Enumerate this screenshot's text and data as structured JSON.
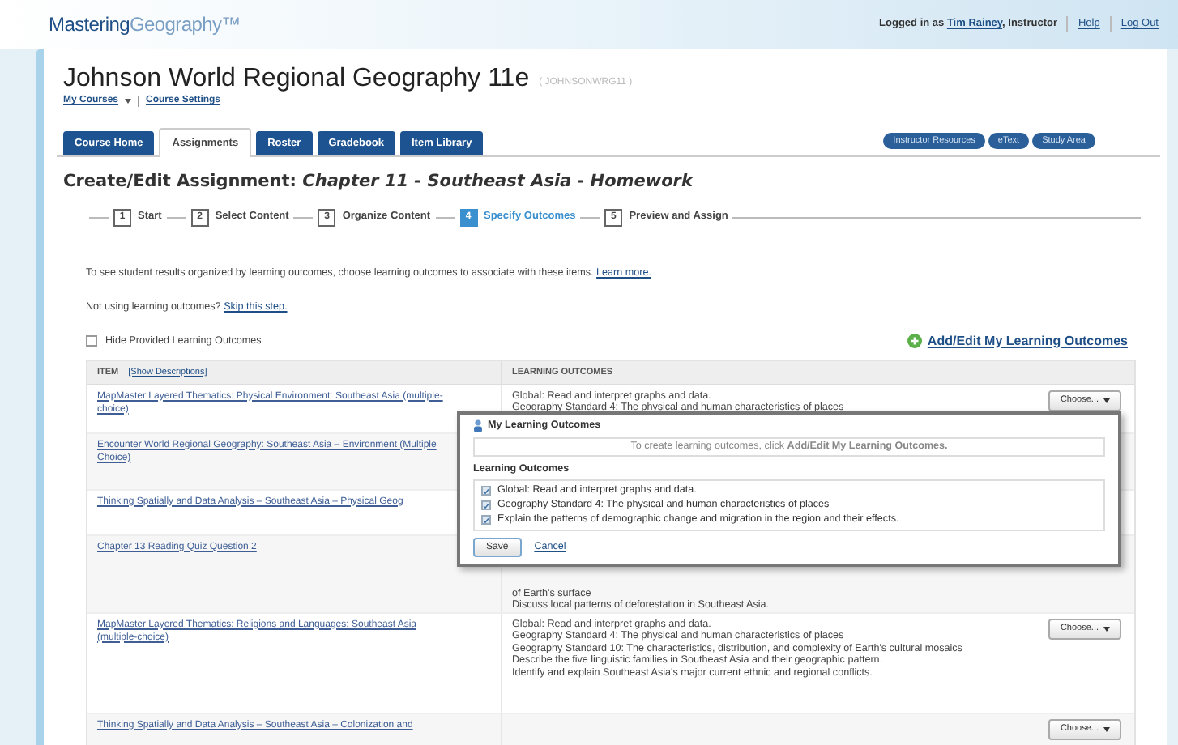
{
  "header": {
    "logo": [
      "Mastering",
      "Geography™"
    ],
    "login_prefix": "Logged in as",
    "user": "Tim Rainey",
    "role": ", Instructor",
    "links": [
      "Help",
      "Log Out"
    ]
  },
  "course": {
    "title": "Johnson World Regional Geography 11e",
    "code": "( JOHNSONWRG11 )",
    "links": [
      {
        "label": "My Courses",
        "dropdown": true
      },
      {
        "label": "Course Settings",
        "dropdown": false
      }
    ]
  },
  "tabs": [
    {
      "label": "Course Home",
      "selected": false
    },
    {
      "label": "Assignments",
      "selected": true
    },
    {
      "label": "Roster",
      "selected": false
    },
    {
      "label": "Gradebook",
      "selected": false
    },
    {
      "label": "Item Library",
      "selected": false
    }
  ],
  "resource_buttons": [
    "Instructor Resources",
    "eText",
    "Study Area"
  ],
  "page_title": "Create/Edit Assignment: *Chapter 11 - Southeast Asia - Homework*",
  "steps": [
    {
      "number": "1",
      "label": "Start",
      "selected": false
    },
    {
      "number": "2",
      "label": "Select Content",
      "selected": false
    },
    {
      "number": "3",
      "label": "Organize Content",
      "selected": false
    },
    {
      "number": "4",
      "label": "Specify Outcomes",
      "selected": true
    },
    {
      "number": "5",
      "label": "Preview and Assign",
      "selected": false
    }
  ],
  "intro": {
    "text": "To see student results organized by learning outcomes, choose learning outcomes to associate with these items.",
    "link": "Learn more."
  },
  "skip": {
    "text": "Not using learning outcomes?",
    "link": "Skip this step."
  },
  "hide_provided": {
    "label": "Hide Provided Learning Outcomes",
    "checked": false
  },
  "add_edit_link": "Add/Edit My Learning Outcomes",
  "table": {
    "columns": [
      {
        "label": "ITEM",
        "link": "[Show Descriptions]"
      },
      {
        "label": "LEARNING OUTCOMES"
      }
    ],
    "rows": [
      {
        "item": "MapMaster Layered Thematics: Physical Environment: Southeast Asia (multiple-choice)",
        "outcomes": [
          "Global: Read and interpret graphs and data.",
          "Geography Standard 4: The physical and human characteristics of places"
        ],
        "button": "Choose..."
      },
      {
        "item": "Encounter World Regional Geography: Southeast Asia – Environment (Multiple Choice)"
      },
      {
        "item": "Thinking Spatially and Data Analysis – Southeast Asia – Physical Geog"
      },
      {
        "item": "Chapter 13 Reading Quiz Question 2",
        "outcomes": [
          "of Earth's surface",
          "Discuss local patterns of deforestation in Southeast Asia."
        ]
      },
      {
        "item": "MapMaster Layered Thematics: Religions and Languages: Southeast Asia (multiple-choice)",
        "outcomes": [
          "Global: Read and interpret graphs and data.",
          "Geography Standard 4: The physical and human characteristics of places",
          "Geography Standard 10: The characteristics, distribution, and complexity of Earth's cultural mosaics",
          "Describe the five linguistic families in Southeast Asia and their geographic pattern.",
          "Identify and explain Southeast Asia's major current ethnic and regional conflicts."
        ],
        "button": "Choose..."
      },
      {
        "item": "Thinking Spatially and Data Analysis – Southeast Asia – Colonization and",
        "button": "Choose..."
      }
    ]
  },
  "popup": {
    "title": "My Learning Outcomes",
    "info": "To create learning outcomes, click **Add/Edit My Learning Outcomes.**",
    "section": "Learning Outcomes",
    "outcomes": [
      {
        "label": "Global: Read and interpret graphs and data.",
        "checked": true
      },
      {
        "label": "Geography Standard 4: The physical and human characteristics of places",
        "checked": true
      },
      {
        "label": "Explain the patterns of demographic change and migration in the region and their effects.",
        "checked": true
      }
    ],
    "save": "Save",
    "cancel": "Cancel"
  }
}
